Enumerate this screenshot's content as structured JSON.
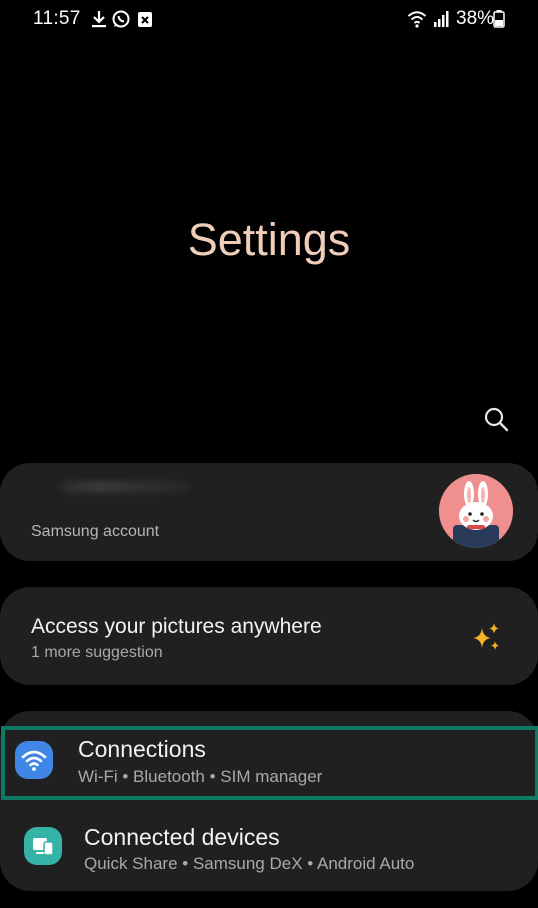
{
  "status_bar": {
    "time": "11:57",
    "battery_text": "38%",
    "left_icons": [
      "download-icon",
      "whatsapp-icon",
      "notification-x-icon"
    ],
    "right_icons": [
      "wifi-icon",
      "signal-icon",
      "battery-icon"
    ]
  },
  "header": {
    "title": "Settings",
    "title_color": "#efcdb8",
    "search_icon": "search-icon"
  },
  "account": {
    "label": "Samsung account",
    "avatar_icon": "bunny-avatar"
  },
  "suggestion": {
    "title": "Access your pictures anywhere",
    "subtitle": "1 more suggestion",
    "icon": "sparkle-icon",
    "icon_color": "#f5b324"
  },
  "settings_items": [
    {
      "title": "Connections",
      "subtitle": "Wi-Fi  •  Bluetooth  •  SIM manager",
      "icon": "wifi-settings-icon",
      "icon_color": "#3f86e6",
      "highlighted": true
    },
    {
      "title": "Connected devices",
      "subtitle": "Quick Share  •  Samsung DeX  •  Android Auto",
      "icon": "connected-devices-icon",
      "icon_color": "#35b3a6"
    }
  ],
  "colors": {
    "background": "#000000",
    "card": "#202020",
    "highlight_border": "#0f7a63"
  }
}
